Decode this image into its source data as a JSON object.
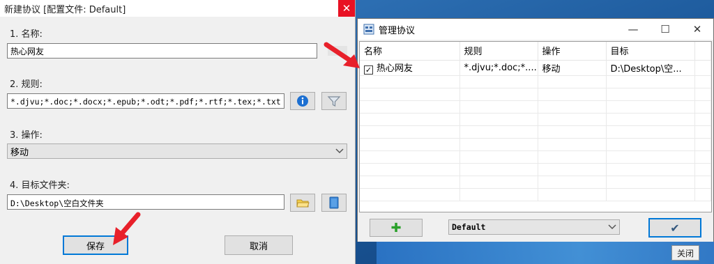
{
  "left_dialog": {
    "title": "新建协议 [配置文件: Default]",
    "close_glyph": "✕",
    "name_label": "1. 名称:",
    "name_value": "热心网友",
    "rule_label": "2. 规则:",
    "rule_value": "*.djvu;*.doc;*.docx;*.epub;*.odt;*.pdf;*.rtf;*.tex;*.txt",
    "action_label": "3. 操作:",
    "action_value": "移动",
    "target_label": "4. 目标文件夹:",
    "target_value": "D:\\Desktop\\空白文件夹",
    "save_label": "保存",
    "cancel_label": "取消"
  },
  "right_dialog": {
    "title": "管理协议",
    "min_glyph": "—",
    "max_glyph": "☐",
    "close_glyph": "✕",
    "columns": [
      "名称",
      "规则",
      "操作",
      "目标"
    ],
    "rows": [
      {
        "checked": true,
        "check_glyph": "✓",
        "name": "热心网友",
        "rule": "*.djvu;*.doc;*....",
        "action": "移动",
        "target": "D:\\Desktop\\空..."
      }
    ],
    "profile_value": "Default",
    "add_glyph": "✚",
    "ok_glyph": "✔"
  },
  "desktop": {
    "close_tooltip": "关闭"
  },
  "colors": {
    "accent": "#0078d7",
    "close_red": "#e81123",
    "arrow_red": "#e8202a"
  }
}
